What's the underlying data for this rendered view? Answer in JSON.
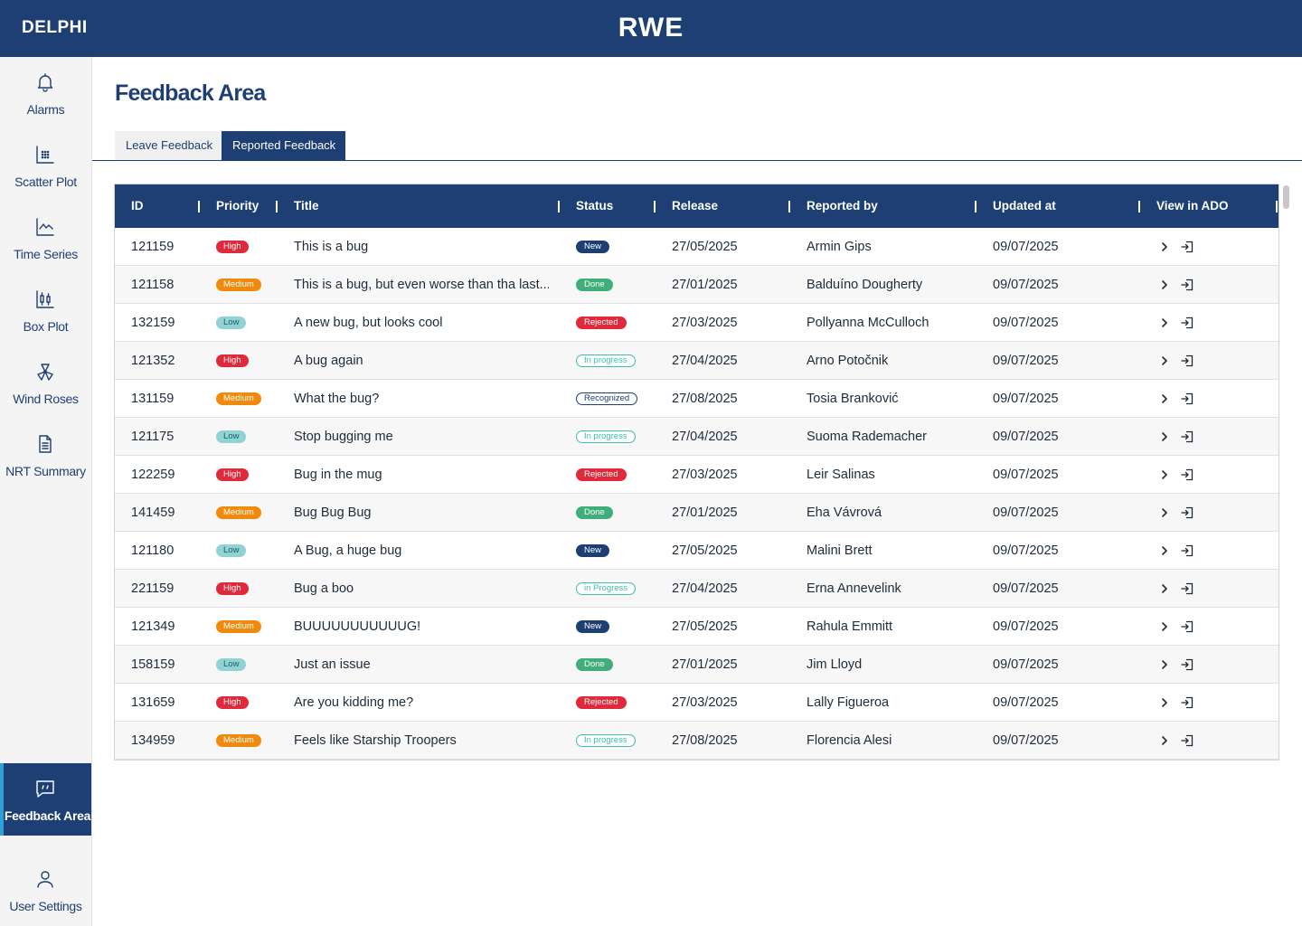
{
  "header": {
    "app_name": "DELPHI",
    "brand": "RWE"
  },
  "sidebar": {
    "items": [
      {
        "label": "Alarms",
        "icon": "bell-icon"
      },
      {
        "label": "Scatter Plot",
        "icon": "scatter-plot-icon"
      },
      {
        "label": "Time Series",
        "icon": "line-chart-icon"
      },
      {
        "label": "Box Plot",
        "icon": "box-plot-icon"
      },
      {
        "label": "Wind Roses",
        "icon": "wind-rose-icon"
      },
      {
        "label": "NRT Summary",
        "icon": "document-icon"
      },
      {
        "label": "Feedback Area",
        "icon": "chat-icon",
        "active": true
      },
      {
        "label": "User Settings",
        "icon": "user-icon"
      }
    ]
  },
  "page": {
    "title": "Feedback Area"
  },
  "tabs": [
    {
      "label": "Leave Feedback",
      "active": false
    },
    {
      "label": "Reported Feedback",
      "active": true
    }
  ],
  "table": {
    "columns": {
      "id": "ID",
      "priority": "Priority",
      "title": "Title",
      "status": "Status",
      "release": "Release",
      "reported_by": "Reported by",
      "updated_at": "Updated at",
      "view_in_ado": "View in ADO"
    },
    "rows": [
      {
        "id": "121159",
        "priority": "High",
        "title": "This is a bug",
        "status": "New",
        "release": "27/05/2025",
        "reported_by": "Armin Gips",
        "updated_at": "09/07/2025"
      },
      {
        "id": "121158",
        "priority": "Medium",
        "title": "This is a bug, but even worse than tha last...",
        "status": "Done",
        "release": "27/01/2025",
        "reported_by": "Balduíno Dougherty",
        "updated_at": "09/07/2025"
      },
      {
        "id": "132159",
        "priority": "Low",
        "title": "A new bug, but looks cool",
        "status": "Rejected",
        "release": "27/03/2025",
        "reported_by": "Pollyanna McCulloch",
        "updated_at": "09/07/2025"
      },
      {
        "id": "121352",
        "priority": "High",
        "title": "A bug again",
        "status": "In progress",
        "release": "27/04/2025",
        "reported_by": "Arno Potočnik",
        "updated_at": "09/07/2025"
      },
      {
        "id": "131159",
        "priority": "Medium",
        "title": "What the bug?",
        "status": "Recognized",
        "release": "27/08/2025",
        "reported_by": "Tosia Branković",
        "updated_at": "09/07/2025"
      },
      {
        "id": "121175",
        "priority": "Low",
        "title": "Stop bugging me",
        "status": "In progress",
        "release": "27/04/2025",
        "reported_by": "Suoma Rademacher",
        "updated_at": "09/07/2025"
      },
      {
        "id": "122259",
        "priority": "High",
        "title": "Bug in the mug",
        "status": "Rejected",
        "release": "27/03/2025",
        "reported_by": "Leir Salinas",
        "updated_at": "09/07/2025"
      },
      {
        "id": "141459",
        "priority": "Medium",
        "title": "Bug Bug Bug",
        "status": "Done",
        "release": "27/01/2025",
        "reported_by": "Eha Vávrová",
        "updated_at": "09/07/2025"
      },
      {
        "id": "121180",
        "priority": "Low",
        "title": "A Bug, a huge bug",
        "status": "New",
        "release": "27/05/2025",
        "reported_by": "Malini Brett",
        "updated_at": "09/07/2025"
      },
      {
        "id": "221159",
        "priority": "High",
        "title": "Bug a boo",
        "status": "in Progress",
        "release": "27/04/2025",
        "reported_by": "Erna Annevelink",
        "updated_at": "09/07/2025"
      },
      {
        "id": "121349",
        "priority": "Medium",
        "title": "BUUUUUUUUUUUG!",
        "status": "New",
        "release": "27/05/2025",
        "reported_by": "Rahula Emmitt",
        "updated_at": "09/07/2025"
      },
      {
        "id": "158159",
        "priority": "Low",
        "title": "Just an issue",
        "status": "Done",
        "release": "27/01/2025",
        "reported_by": "Jim Lloyd",
        "updated_at": "09/07/2025"
      },
      {
        "id": "131659",
        "priority": "High",
        "title": "Are you kidding me?",
        "status": "Rejected",
        "release": "27/03/2025",
        "reported_by": "Lally Figueroa",
        "updated_at": "09/07/2025"
      },
      {
        "id": "134959",
        "priority": "Medium",
        "title": "Feels like Starship Troopers",
        "status": "In  progress",
        "release": "27/08/2025",
        "reported_by": "Florencia Alesi",
        "updated_at": "09/07/2025"
      }
    ]
  },
  "colors": {
    "primary": "#1d3f73",
    "accent": "#2f9fd8",
    "priority_high": "#e02a3b",
    "priority_medium": "#f08a0c",
    "priority_low": "#8fd3d5",
    "status_new": "#1d3f73",
    "status_done": "#3fae7a",
    "status_rejected": "#e02a3b",
    "status_in_progress": "#3fbfa8",
    "status_recognized": "#1d3f73"
  }
}
